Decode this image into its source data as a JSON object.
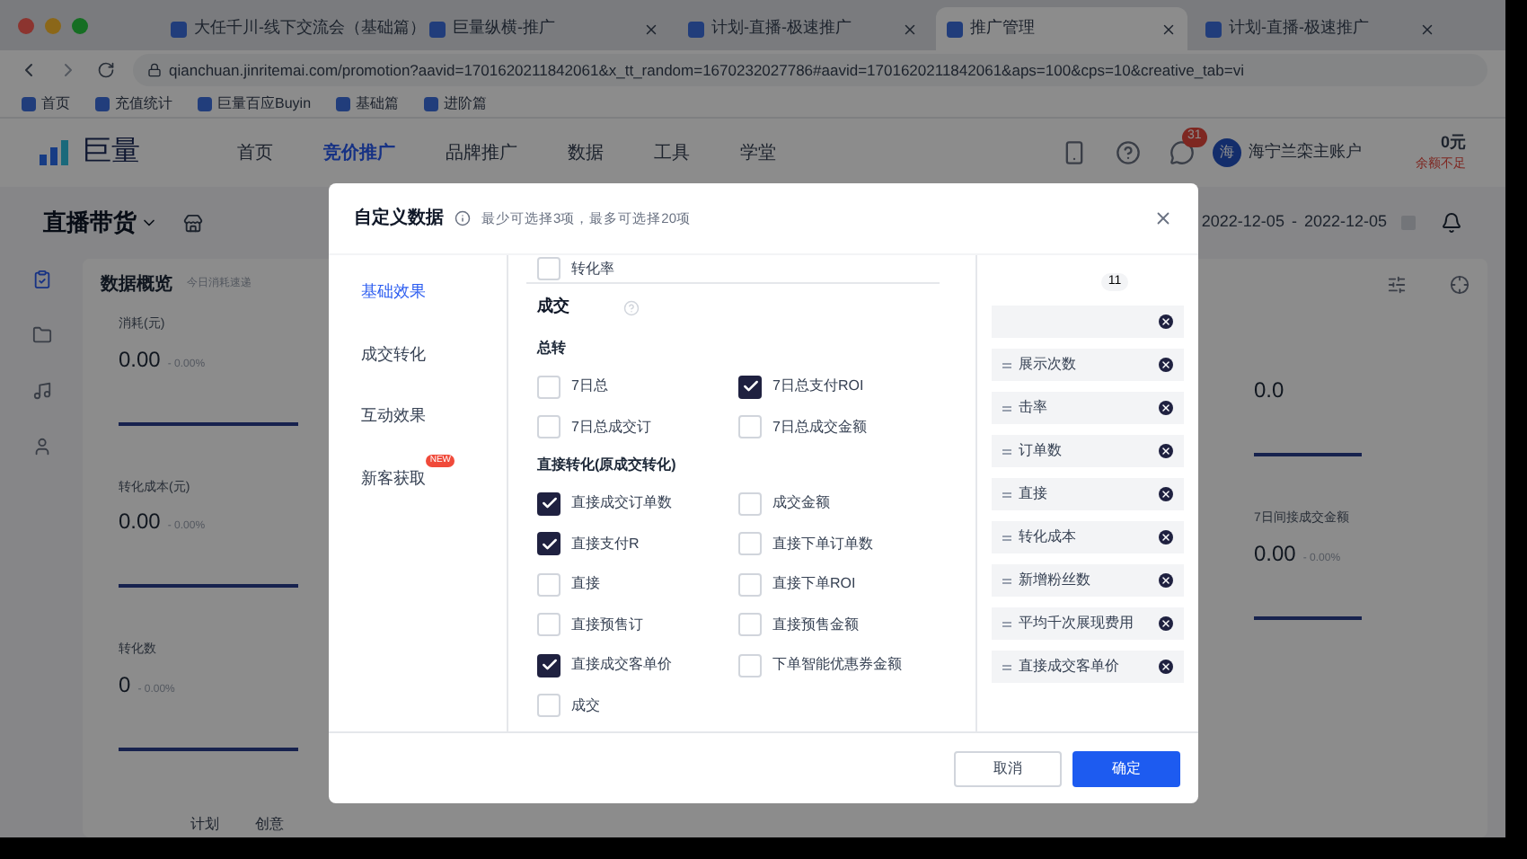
{
  "browser": {
    "tabs": [
      {
        "title": "大任千川-线下交流会（基础篇）",
        "selected": false
      },
      {
        "title": "巨量纵横-推广",
        "selected": false
      },
      {
        "title": "计划-直播-极速推广",
        "selected": false
      },
      {
        "title": "推广管理",
        "selected": true
      },
      {
        "title": "计划-直播-极速推广",
        "selected": false
      }
    ],
    "url": "qianchuan.jinritemai.com/promotion?aavid=1701620211842061&x_tt_random=1670232027786#aavid=1701620211842061&aps=100&cps=10&creative_tab=vi",
    "bookmarks": [
      "首页",
      "充值统计",
      "巨量百应Buyin",
      "基础篇",
      "进阶篇"
    ]
  },
  "app": {
    "logo": "巨量",
    "nav": [
      {
        "label": "首页",
        "selected": false
      },
      {
        "label": "竞价推广",
        "selected": true
      },
      {
        "label": "品牌推广",
        "selected": false
      },
      {
        "label": "数据",
        "selected": false
      },
      {
        "label": "工具",
        "selected": false
      },
      {
        "label": "学堂",
        "selected": false
      }
    ],
    "notification_count": "31",
    "avatar": "海",
    "account": "海宁兰栾主账户",
    "balance": "0元",
    "balance_note": "余额不足",
    "scene": "直播带货",
    "date_start": "2022-12-05",
    "date_separator": "-",
    "date_end": "2022-12-05",
    "overview_title": "数据概览",
    "overview_note": "今日消耗速递",
    "metrics": [
      {
        "label": "消耗(元)",
        "value": "0.00",
        "change": "- 0.00%"
      },
      {
        "label": "转化成本(元)",
        "value": "0.00",
        "change": "- 0.00%"
      },
      {
        "label": "转化数",
        "value": "0",
        "change": "- 0.00%"
      }
    ],
    "metrics_right": [
      {
        "value": "0.0"
      },
      {
        "label": "7日间接成交金额",
        "value": "0.00",
        "change": "- 0.00%"
      }
    ],
    "bottom_tabs": [
      "计划",
      "创意"
    ]
  },
  "dialog": {
    "title": "自定义数据",
    "hint": "最少可选择3项，最多可选择20项",
    "categories": [
      {
        "label": "基础效果",
        "selected": true
      },
      {
        "label": "成交转化",
        "selected": false
      },
      {
        "label": "互动效果",
        "selected": false
      },
      {
        "label": "新客获取",
        "selected": false,
        "badge": "NEW"
      }
    ],
    "top_option": {
      "label": "转化率",
      "checked": false
    },
    "section": "成交",
    "groups": [
      {
        "title": "总转",
        "options": [
          {
            "label": "7日总",
            "checked": false
          },
          {
            "label": "7日总支付ROI",
            "checked": true
          },
          {
            "label": "7日总成交订",
            "checked": false
          },
          {
            "label": "7日总成交金额",
            "checked": false
          }
        ]
      },
      {
        "title": "直接转化(原成交转化)",
        "options": [
          {
            "label": "直接成交订单数",
            "checked": true
          },
          {
            "label": "成交金额",
            "checked": false
          },
          {
            "label": "直接支付R",
            "checked": true
          },
          {
            "label": "直接下单订单数",
            "checked": false
          },
          {
            "label": "直接",
            "checked": false
          },
          {
            "label": "直接下单ROI",
            "checked": false
          },
          {
            "label": "直接预售订",
            "checked": false
          },
          {
            "label": "直接预售金额",
            "checked": false
          },
          {
            "label": "直接成交客单价",
            "checked": true
          },
          {
            "label": "下单智能优惠券金额",
            "checked": false
          },
          {
            "label": "成交",
            "checked": false
          }
        ]
      }
    ],
    "selected_count": "11",
    "selected_items": [
      "展示次数",
      "击率",
      "订单数",
      "直接",
      "转化成本",
      "新增粉丝数",
      "平均千次展现费用",
      "直接成交客单价"
    ],
    "buttons": [
      {
        "label": "取消",
        "kind": "secondary"
      },
      {
        "label": "确定",
        "kind": "primary"
      }
    ]
  }
}
